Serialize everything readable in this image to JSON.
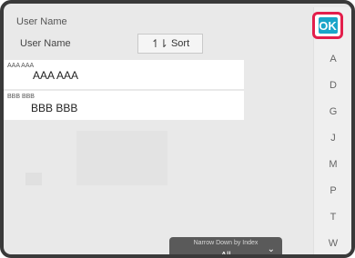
{
  "header": {
    "title": "User Name"
  },
  "list": {
    "column_label": "User Name",
    "sort_label": "Sort",
    "items": [
      {
        "reading": "AAA AAA",
        "name": "AAA AAA"
      },
      {
        "reading": "BBB BBB",
        "name": "BBB BBB"
      }
    ]
  },
  "index": {
    "letters": [
      "A",
      "D",
      "G",
      "J",
      "M",
      "P",
      "T",
      "W"
    ]
  },
  "ok_label": "OK",
  "narrow_down": {
    "caption": "Narrow Down by Index",
    "value": "All"
  },
  "icons": {
    "sort": "sort-icon",
    "chevron": "chevron-down-icon"
  },
  "colors": {
    "ok_button": "#1aa5c9",
    "highlight_border": "#e31e4b",
    "narrow_bar": "#5a5a5a"
  }
}
